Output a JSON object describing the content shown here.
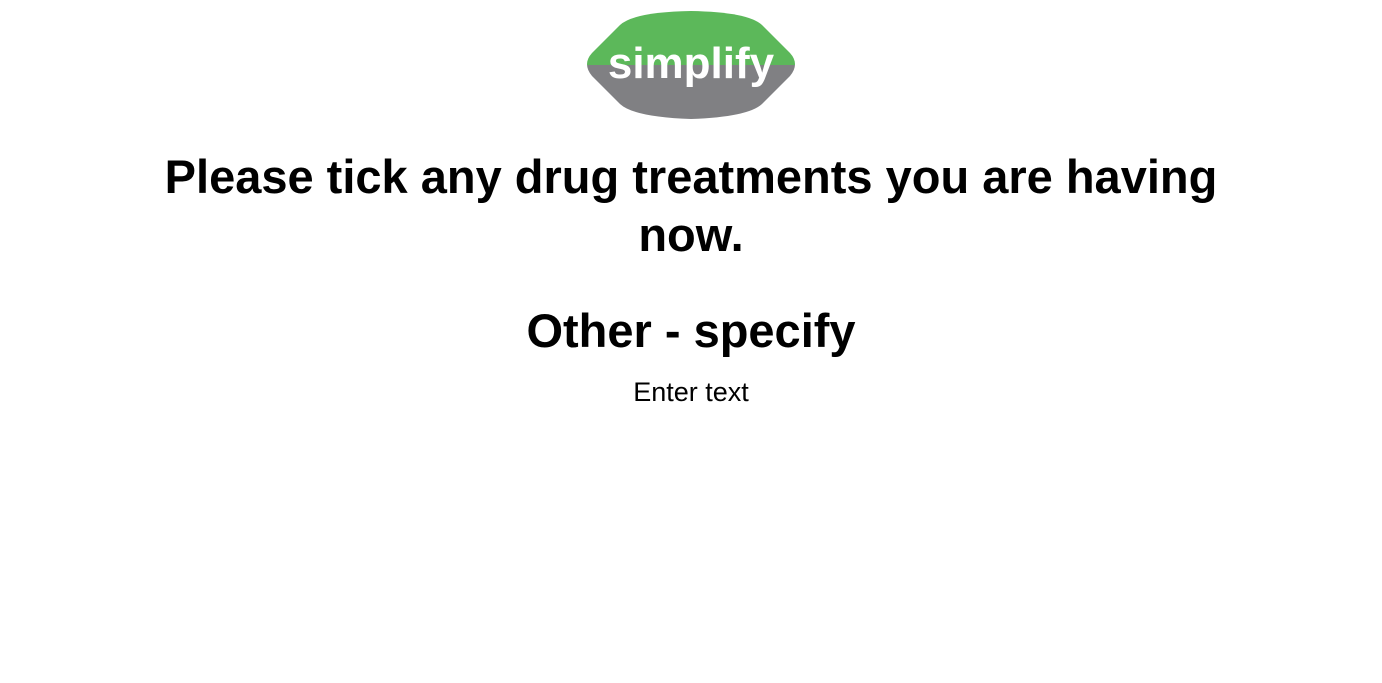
{
  "logo": {
    "text": "simplify",
    "colors": {
      "top": "#5cb85a",
      "bottom": "#808083",
      "text": "#ffffff"
    }
  },
  "question": {
    "title": "Please tick any drug treatments you are having now.",
    "sub_title": "Other - specify"
  },
  "input": {
    "placeholder": "Enter text",
    "value": ""
  }
}
